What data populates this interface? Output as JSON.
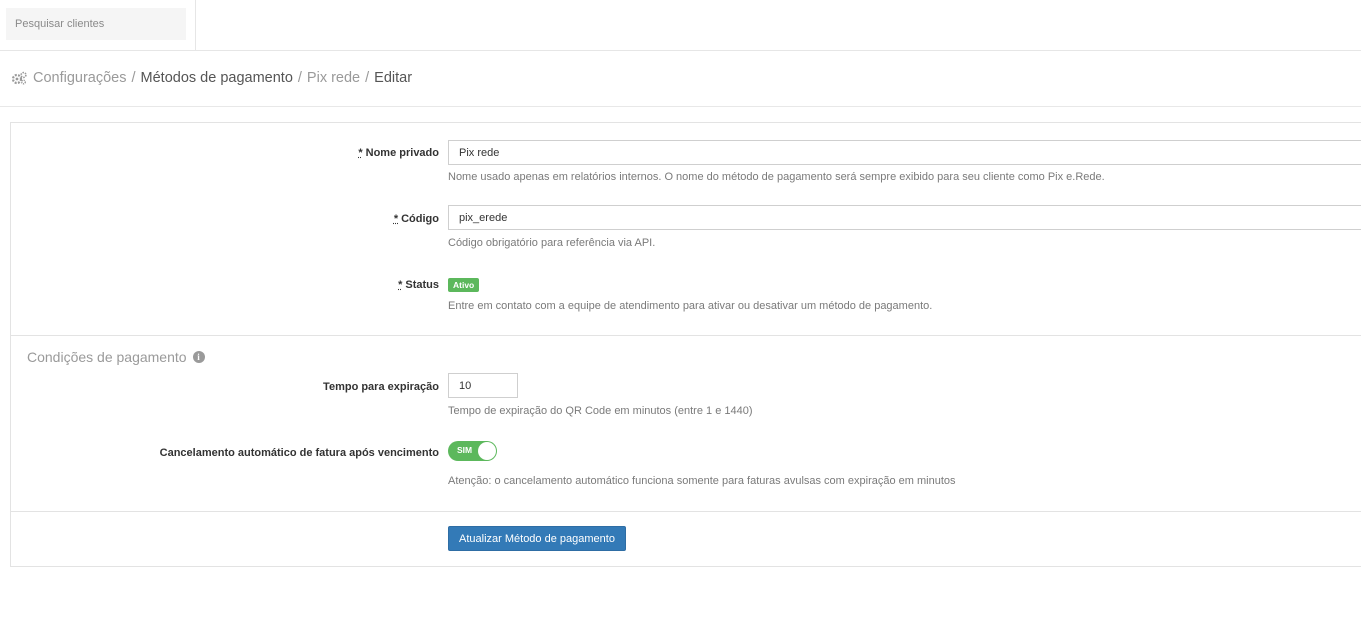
{
  "search": {
    "placeholder": "Pesquisar clientes"
  },
  "breadcrumb": {
    "items": [
      "Configurações",
      "Métodos de pagamento",
      "Pix rede",
      "Editar"
    ],
    "separator": "/"
  },
  "form": {
    "required_mark": "*",
    "nome_privado": {
      "label": "Nome privado",
      "value": "Pix rede",
      "help": "Nome usado apenas em relatórios internos. O nome do método de pagamento será sempre exibido para seu cliente como Pix e.Rede."
    },
    "codigo": {
      "label": "Código",
      "value": "pix_erede",
      "help": "Código obrigatório para referência via API."
    },
    "status": {
      "label": "Status",
      "badge": "Ativo",
      "help": "Entre em contato com a equipe de atendimento para ativar ou desativar um método de pagamento."
    }
  },
  "conditions": {
    "title": "Condições de pagamento",
    "info_icon": "i",
    "expiracao": {
      "label": "Tempo para expiração",
      "value": "10",
      "help": "Tempo de expiração do QR Code em minutos (entre 1 e 1440)"
    },
    "cancelamento": {
      "label": "Cancelamento automático de fatura após vencimento",
      "toggle_label": "SIM",
      "help": "Atenção: o cancelamento automático funciona somente para faturas avulsas com expiração em minutos"
    }
  },
  "actions": {
    "submit_label": "Atualizar Método de pagamento"
  },
  "colors": {
    "primary": "#337ab7",
    "success": "#5cb85c"
  }
}
